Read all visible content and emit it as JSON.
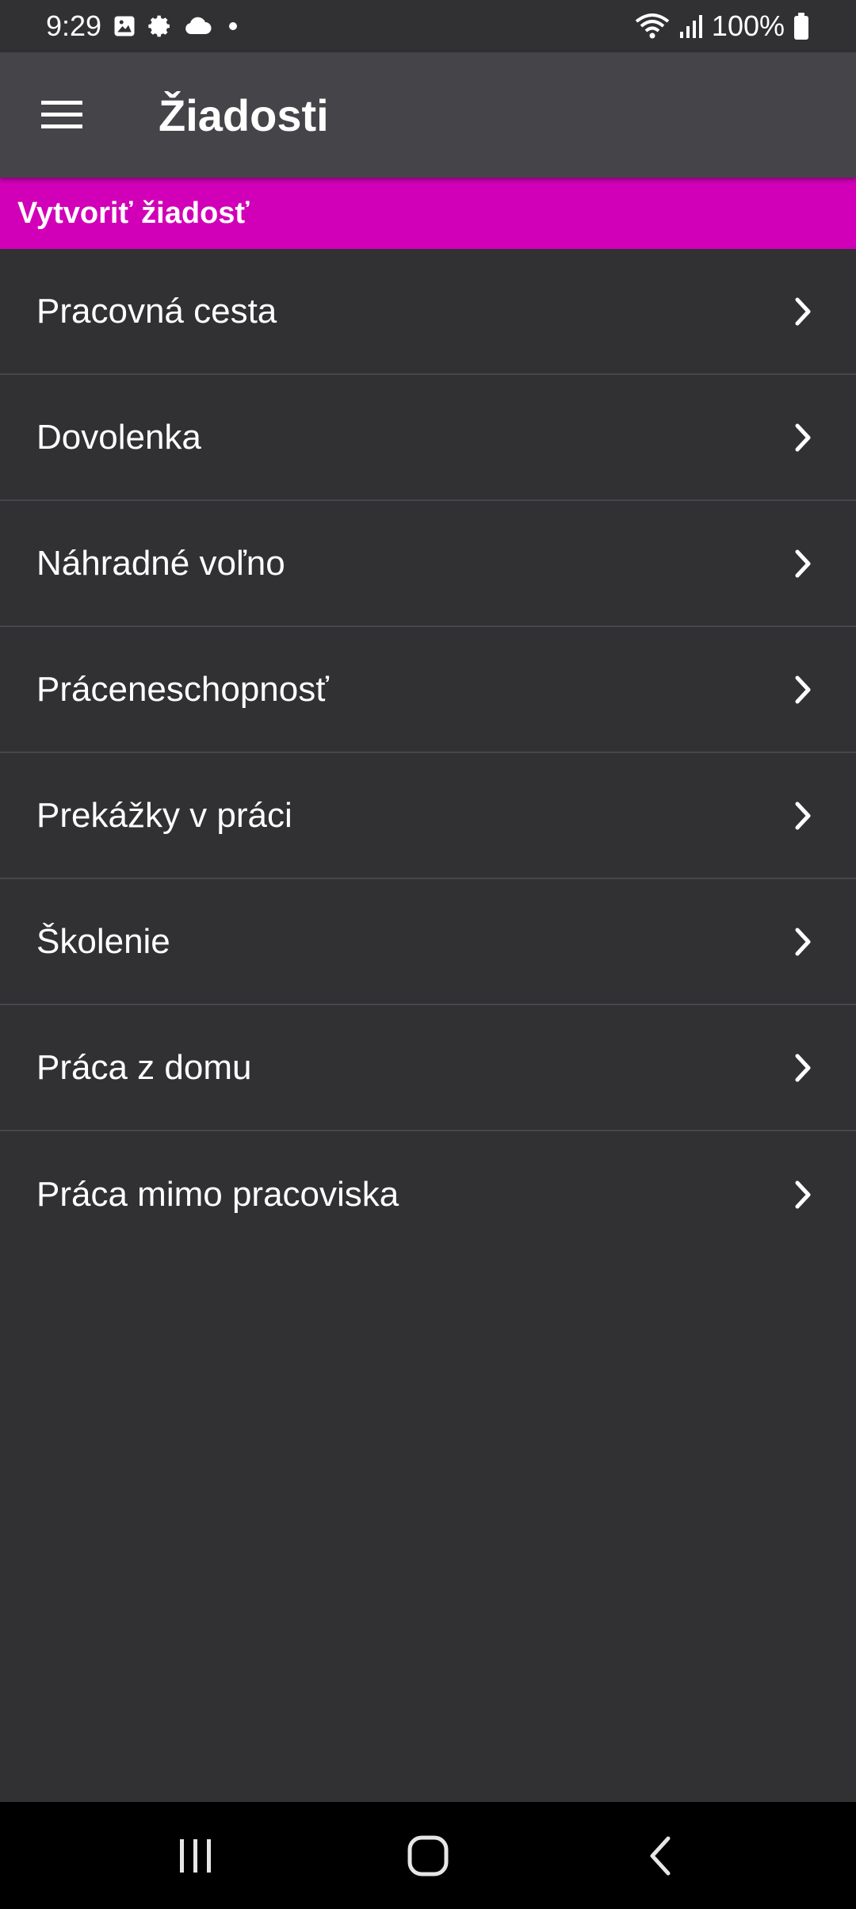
{
  "status_bar": {
    "time": "9:29",
    "battery": "100%",
    "icons": [
      "gallery-icon",
      "settings-icon",
      "cloud-icon",
      "dot-icon",
      "wifi-icon",
      "signal-icon",
      "battery-icon"
    ]
  },
  "app_bar": {
    "title": "Žiadosti",
    "menu_icon": "hamburger-menu-icon"
  },
  "section": {
    "header": "Vytvoriť žiadosť"
  },
  "requests": [
    {
      "label": "Pracovná cesta"
    },
    {
      "label": "Dovolenka"
    },
    {
      "label": "Náhradné voľno"
    },
    {
      "label": "Práceneschopnosť"
    },
    {
      "label": "Prekážky v práci"
    },
    {
      "label": "Školenie"
    },
    {
      "label": "Práca z domu"
    },
    {
      "label": "Práca mimo pracoviska"
    }
  ],
  "colors": {
    "background": "#313033",
    "app_bar": "#454448",
    "accent": "#d100b8",
    "divider": "#47464a",
    "nav_bar": "#000000"
  },
  "nav_bar": {
    "buttons": [
      "recent-apps-icon",
      "home-icon",
      "back-icon"
    ]
  }
}
